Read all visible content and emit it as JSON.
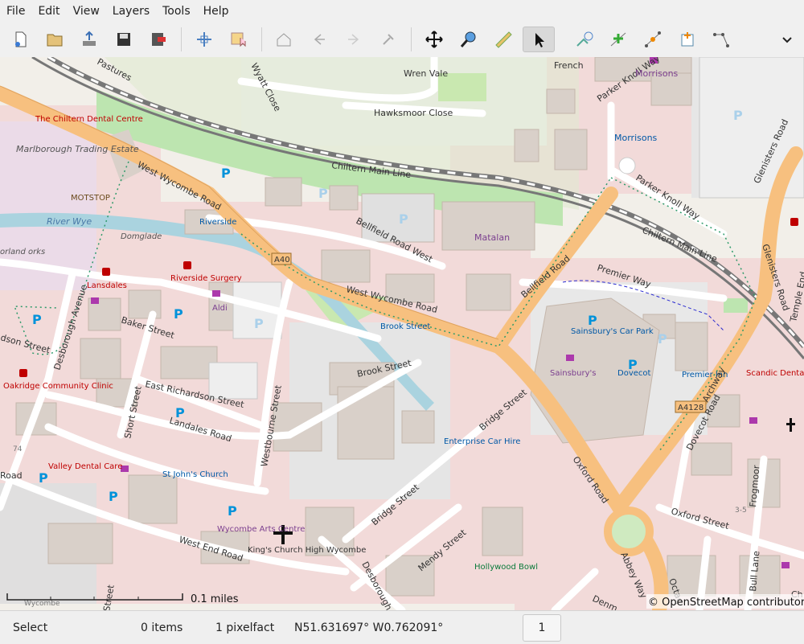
{
  "menu": [
    "File",
    "Edit",
    "View",
    "Layers",
    "Tools",
    "Help"
  ],
  "toolbar_icons": [
    "new-file-icon",
    "open-file-icon",
    "upload-icon",
    "save-icon",
    "exit-icon",
    "zoom-extent-icon",
    "download-area-icon",
    "home-icon",
    "undo-icon",
    "redo-icon",
    "preferences-icon",
    "move-icon",
    "zoom-icon",
    "measure-icon",
    "select-icon",
    "draw-icon",
    "add-node-icon",
    "improve-way-icon",
    "add-poi-icon",
    "split-way-icon",
    "overflow-chevron-icon"
  ],
  "map": {
    "scale_label": "0.1 miles",
    "attribution": "© OpenStreetMap contributors",
    "labels": {
      "wren_vale": "Wren Vale",
      "hawksmoor_close": "Hawksmoor Close",
      "wyatt_close": "Wyatt Close",
      "pastures": "Pastures",
      "chiltern_main_line_1": "Chiltern Main Line",
      "chiltern_main_line_2": "Chiltern Main Line",
      "parker_knoll_way_1": "Parker Knoll Way",
      "parker_knoll_way_2": "Parker Knoll Way",
      "morrisons_1": "Morrisons",
      "morrisons_2": "Morrisons",
      "tucker_french": "French",
      "glenisters_road_1": "Glenisters Road",
      "glenisters_road_2": "Glenisters Road",
      "temple_end": "Temple End",
      "chiltern_dental": "The Chiltern Dental Centre",
      "marlborough": "Marlborough Trading Estate",
      "motstop": "MOTSTOP",
      "west_wycombe_road_1": "West Wycombe Road",
      "west_wycombe_road_2": "West Wycombe Road",
      "riverside": "Riverside",
      "river_wye": "River Wye",
      "domglade": "Domglade",
      "a40": "A40",
      "bellfield_road_west": "Bellfield Road West",
      "bellfield_road": "Bellfield Road",
      "matalan": "Matalan",
      "premier_way": "Premier Way",
      "lansdales": "Lansdales",
      "riverside_surgery": "Riverside Surgery",
      "aldi": "Aldi",
      "orland_works": "orland orks",
      "baker_street": "Baker Street",
      "brook_street_stop": "Brook Street",
      "brook_street": "Brook Street",
      "dson_street": "dson Street",
      "desborough_avenue": "Desborough Avenue",
      "oakridge": "Oakridge Community Clinic",
      "east_richardson": "East Richardson Street",
      "westbourne": "Westbourne Street",
      "landales_road": "Landales Road",
      "short_street": "Short Street",
      "sainsburys_car_park": "Sainsbury's Car Park",
      "sainsburys": "Sainsbury's",
      "dovecot": "Dovecot",
      "premier_inn": "Premier Inn",
      "scandic": "Scandic Dental Care",
      "archway": "Archway",
      "a4128": "A4128",
      "dovecot_road": "Dovecot Road",
      "bridge_street_1": "Bridge Street",
      "bridge_street_2": "Bridge Street",
      "enterprise": "Enterprise Car Hire",
      "oxford_road_1": "Oxford Road",
      "oxford_road_2": "Oxford Street",
      "valley_dental": "Valley Dental Care",
      "st_johns": "St John's Church",
      "wycombe_arts": "Wycombe Arts Centre",
      "kings_church": "King's Church High Wycombe",
      "west_end_road": "West End Road",
      "mendy_street": "Mendy Street",
      "desborough_road": "Desborough Ro",
      "hollywood_bowl": "Hollywood Bowl",
      "frogmoor": "Frogmoor",
      "bull_lane": "Bull Lane",
      "abbey_way": "Abbey Way",
      "octag": "Octag",
      "road_left": "Road",
      "num_74": "74",
      "num_35": "3-5",
      "wycombe_small": "Wycombe",
      "street_small": "Street",
      "ch_small": "Ch",
      "denm": "Denm"
    }
  },
  "status": {
    "mode": "Select",
    "items": "0 items",
    "pixel": "1 pixelfact",
    "coords": "N51.631697° W0.762091°",
    "zoom": "1"
  }
}
